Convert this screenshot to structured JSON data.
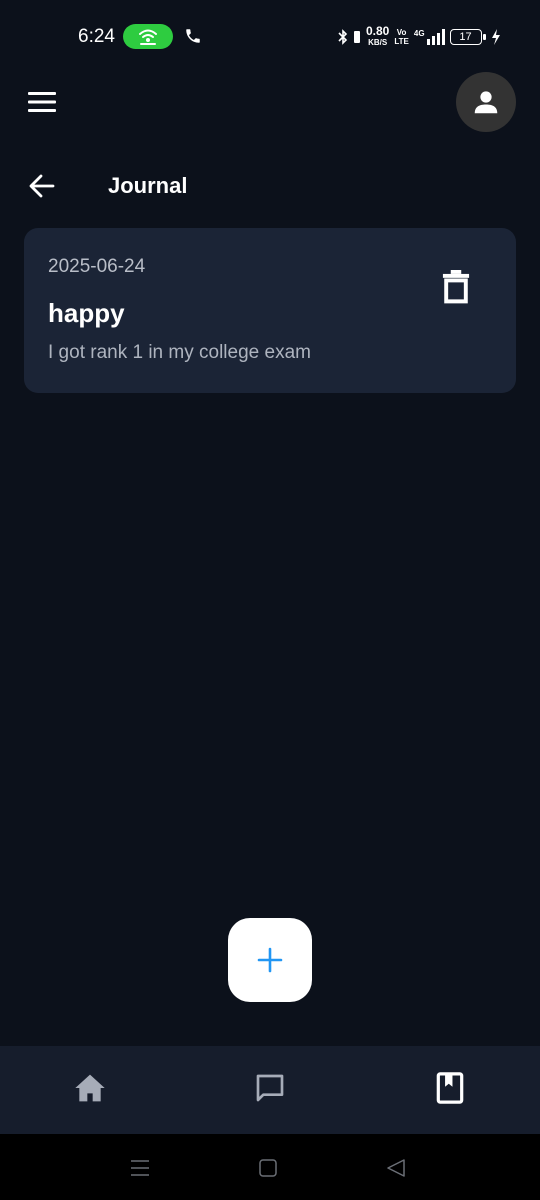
{
  "status_bar": {
    "time": "6:24",
    "net_speed": "0.80",
    "net_unit": "KB/S",
    "volte_top": "Vo",
    "volte_bottom": "LTE",
    "network": "4G",
    "battery": "17"
  },
  "header": {
    "menu_icon": "hamburger-menu-icon",
    "avatar_icon": "person-icon",
    "back_icon": "arrow-left-icon",
    "title": "Journal"
  },
  "entries": [
    {
      "date": "2025-06-24",
      "title": "happy",
      "body": "I got rank 1 in my college exam",
      "delete_icon": "trash-icon"
    }
  ],
  "fab": {
    "icon": "plus-icon"
  },
  "bottom_nav": {
    "items": [
      {
        "icon": "home-icon"
      },
      {
        "icon": "chat-icon"
      },
      {
        "icon": "journal-book-icon"
      }
    ],
    "active": "journal-book-icon"
  },
  "colors": {
    "background": "#0c111b",
    "card": "#1b2436",
    "nav": "#161d2c",
    "accent": "#2196f3",
    "hotspot": "#2ecc40"
  }
}
